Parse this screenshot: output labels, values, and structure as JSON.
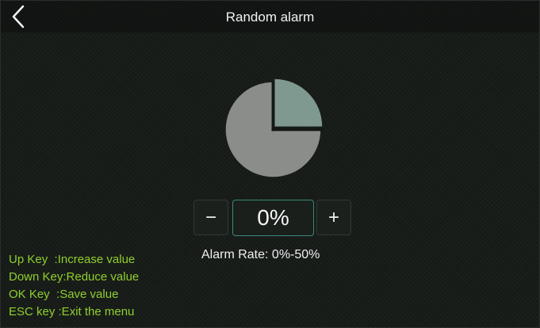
{
  "header": {
    "title": "Random alarm",
    "back_icon": "chevron-left-icon"
  },
  "pie": {
    "percent_highlighted": 25,
    "colors": {
      "main": "#8a8d8a",
      "highlight": "#7f9890"
    }
  },
  "stepper": {
    "minus_label": "−",
    "value": "0%",
    "plus_label": "+"
  },
  "rate_label": "Alarm Rate: 0%-50%",
  "help": {
    "lines": [
      "Up Key  :Increase value",
      "Down Key:Reduce value",
      "OK Key  :Save value",
      "ESC key :Exit the menu"
    ],
    "color": "#8fcf2d"
  }
}
